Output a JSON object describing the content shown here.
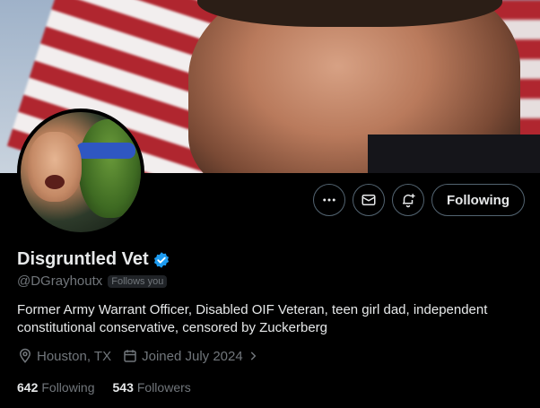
{
  "profile": {
    "display_name": "Disgruntled Vet",
    "handle": "@DGrayhoutx",
    "follows_you": "Follows you",
    "bio": "Former Army Warrant Officer, Disabled OIF Veteran, teen girl dad, independent constitutional conservative, censored by Zuckerberg",
    "location": "Houston, TX",
    "joined": "Joined July 2024",
    "following_count": "642",
    "following_label": "Following",
    "followers_count": "543",
    "followers_label": "Followers",
    "verified": true
  },
  "actions": {
    "more_icon": "more-icon",
    "message_icon": "envelope-icon",
    "notify_icon": "bell-plus-icon",
    "follow_label": "Following"
  },
  "colors": {
    "background": "#000000",
    "text_primary": "#e7e9ea",
    "text_secondary": "#71767b",
    "verified_blue": "#1d9bf0",
    "button_border": "#536471"
  }
}
